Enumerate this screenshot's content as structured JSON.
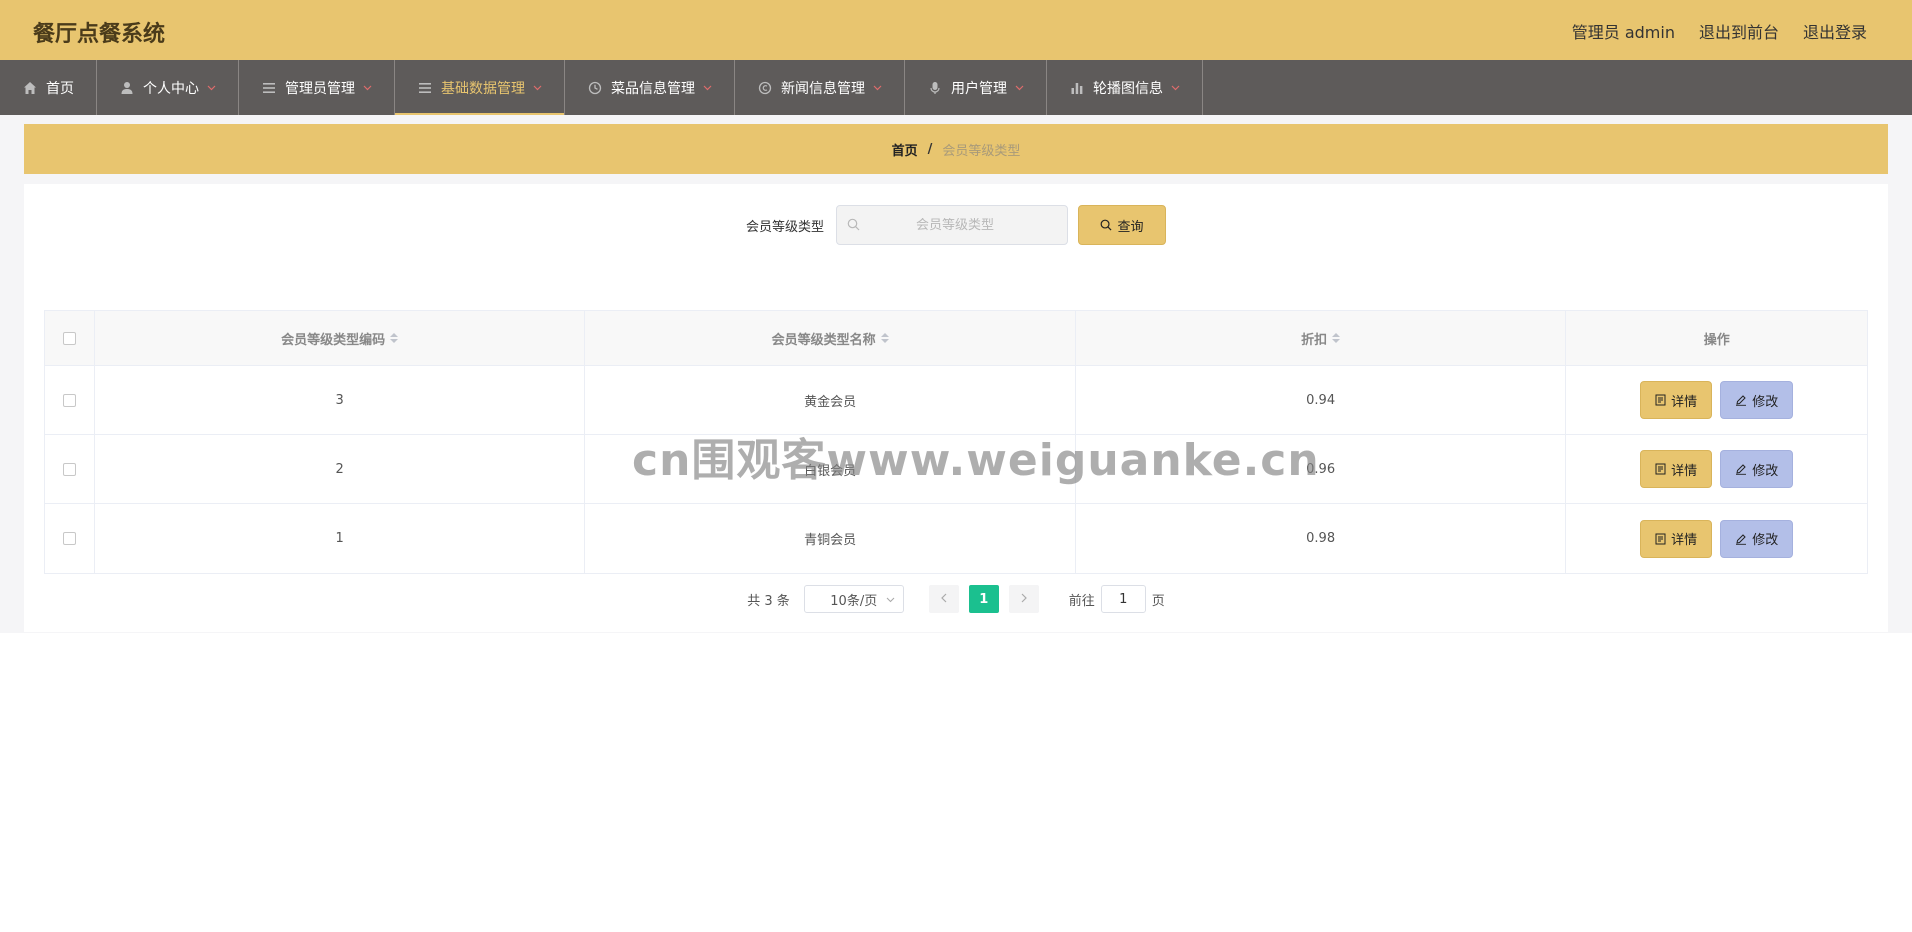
{
  "header": {
    "app_title": "餐厅点餐系统",
    "user_label": "管理员 admin",
    "front_link": "退出到前台",
    "logout_link": "退出登录"
  },
  "nav": {
    "items": [
      {
        "label": "首页",
        "icon": "home-icon",
        "has_dropdown": false
      },
      {
        "label": "个人中心",
        "icon": "user-icon",
        "has_dropdown": true
      },
      {
        "label": "管理员管理",
        "icon": "list-icon",
        "has_dropdown": true
      },
      {
        "label": "基础数据管理",
        "icon": "list-icon",
        "has_dropdown": true,
        "active": true
      },
      {
        "label": "菜品信息管理",
        "icon": "clock-icon",
        "has_dropdown": true
      },
      {
        "label": "新闻信息管理",
        "icon": "copyright-icon",
        "has_dropdown": true
      },
      {
        "label": "用户管理",
        "icon": "mic-icon",
        "has_dropdown": true
      },
      {
        "label": "轮播图信息",
        "icon": "bar-chart-icon",
        "has_dropdown": true
      }
    ]
  },
  "breadcrumb": {
    "home": "首页",
    "separator": "/",
    "current": "会员等级类型"
  },
  "search": {
    "label": "会员等级类型",
    "placeholder": "会员等级类型",
    "value": "",
    "button_label": "查询"
  },
  "table": {
    "columns": [
      "会员等级类型编码",
      "会员等级类型名称",
      "折扣",
      "操作"
    ],
    "rows": [
      {
        "code": "3",
        "name": "黄金会员",
        "discount": "0.94"
      },
      {
        "code": "2",
        "name": "白银会员",
        "discount": "0.96"
      },
      {
        "code": "1",
        "name": "青铜会员",
        "discount": "0.98"
      }
    ],
    "detail_label": "详情",
    "edit_label": "修改"
  },
  "pagination": {
    "total_text": "共 3 条",
    "page_size": "10条/页",
    "current_page": "1",
    "goto_label": "前往",
    "goto_value": "1",
    "page_suffix": "页"
  },
  "watermark": "cn围观客www.weiguanke.cn",
  "colors": {
    "accent": "#e8c56f",
    "nav_bg": "#5e5b5a",
    "edit_button": "#b3bfe8",
    "current_page": "#1bc08f"
  }
}
